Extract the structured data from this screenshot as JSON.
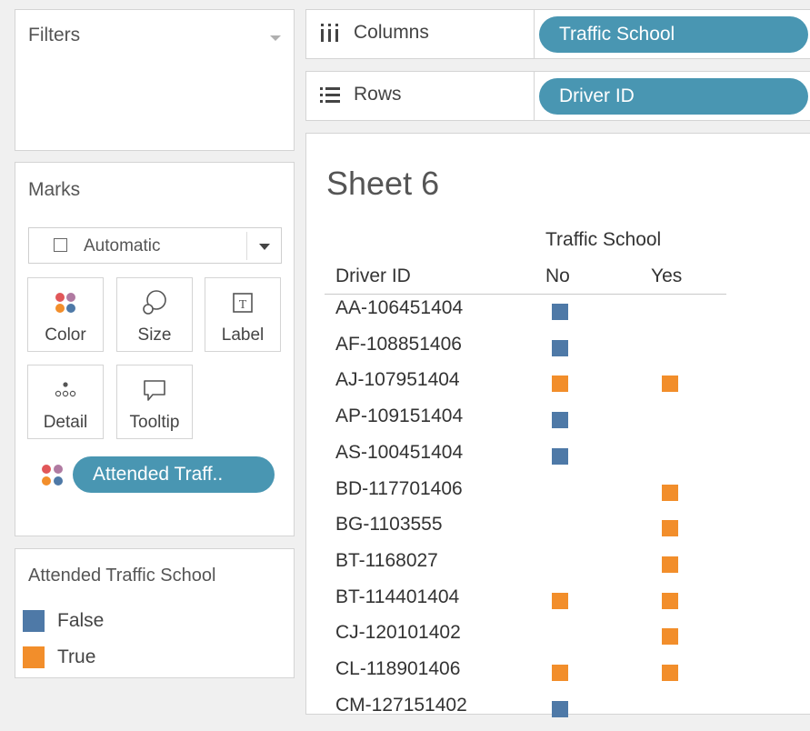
{
  "filters": {
    "title": "Filters"
  },
  "marks": {
    "title": "Marks",
    "type_value": "Automatic",
    "buttons": [
      {
        "label": "Color",
        "icon": "color-dots-icon"
      },
      {
        "label": "Size",
        "icon": "size-icon"
      },
      {
        "label": "Label",
        "icon": "label-icon"
      },
      {
        "label": "Detail",
        "icon": "detail-icon"
      },
      {
        "label": "Tooltip",
        "icon": "tooltip-icon"
      }
    ],
    "color_pill": "Attended Traff.."
  },
  "legend": {
    "title": "Attended Traffic School",
    "items": [
      {
        "label": "False",
        "color": "#4e79a7"
      },
      {
        "label": "True",
        "color": "#f28e2b"
      }
    ]
  },
  "shelves": {
    "columns": {
      "label": "Columns",
      "pill": "Traffic School"
    },
    "rows": {
      "label": "Rows",
      "pill": "Driver ID"
    }
  },
  "sheet": {
    "title": "Sheet 6",
    "column_header": "Traffic School",
    "row_header": "Driver ID",
    "col_no": "No",
    "col_yes": "Yes",
    "rows": [
      {
        "id": "AA-106451404",
        "no": "False",
        "yes": null
      },
      {
        "id": "AF-108851406",
        "no": "False",
        "yes": null
      },
      {
        "id": "AJ-107951404",
        "no": "True",
        "yes": "True"
      },
      {
        "id": "AP-109151404",
        "no": "False",
        "yes": null
      },
      {
        "id": "AS-100451404",
        "no": "False",
        "yes": null
      },
      {
        "id": "BD-117701406",
        "no": null,
        "yes": "True"
      },
      {
        "id": "BG-1103555",
        "no": null,
        "yes": "True"
      },
      {
        "id": "BT-1168027",
        "no": null,
        "yes": "True"
      },
      {
        "id": "BT-114401404",
        "no": "True",
        "yes": "True"
      },
      {
        "id": "CJ-120101402",
        "no": null,
        "yes": "True"
      },
      {
        "id": "CL-118901406",
        "no": "True",
        "yes": "True"
      },
      {
        "id": "CM-127151402",
        "no": "False",
        "yes": null
      }
    ]
  }
}
